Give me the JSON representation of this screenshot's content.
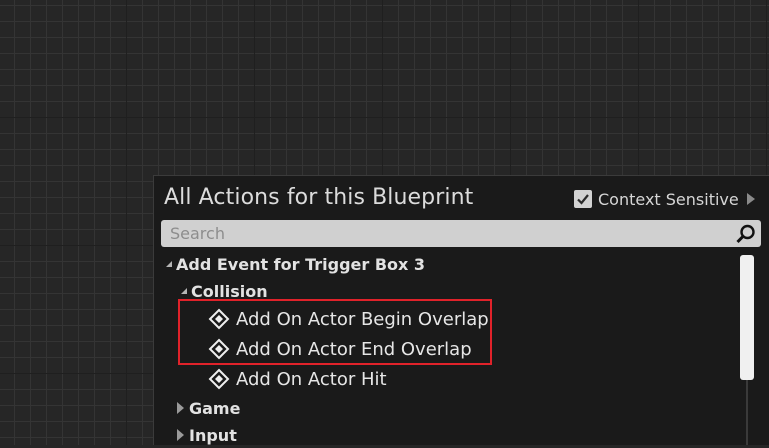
{
  "panel": {
    "title": "All Actions for this Blueprint",
    "context_sensitive_label": "Context Sensitive",
    "context_sensitive_checked": true
  },
  "search": {
    "placeholder": "Search",
    "value": ""
  },
  "tree": {
    "root_label": "Add Event for Trigger Box 3",
    "collision_label": "Collision",
    "items": [
      {
        "label": "Add On Actor Begin Overlap"
      },
      {
        "label": "Add On Actor End Overlap"
      },
      {
        "label": "Add On Actor Hit"
      }
    ],
    "game_label": "Game",
    "input_label": "Input"
  },
  "colors": {
    "highlight": "#e0222a",
    "background": "#262626",
    "panel": "#1a1a1a"
  }
}
